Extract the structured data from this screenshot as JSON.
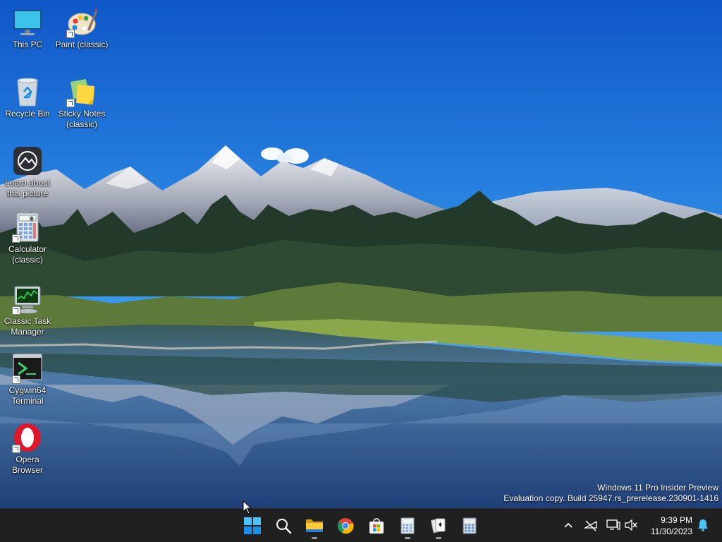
{
  "desktop": {
    "icons": [
      {
        "label": "This PC",
        "icon": "this-pc-icon"
      },
      {
        "label": "Paint (classic)",
        "icon": "paint-icon"
      },
      {
        "label": "Recycle Bin",
        "icon": "recycle-bin-icon"
      },
      {
        "label": "Sticky Notes (classic)",
        "icon": "sticky-notes-icon"
      },
      {
        "label": "Learn about this picture",
        "icon": "camera-icon"
      },
      {
        "label": "Calculator (classic)",
        "icon": "calculator-icon"
      },
      {
        "label": "Classic Task Manager",
        "icon": "task-manager-icon"
      },
      {
        "label": "Cygwin64 Terminal",
        "icon": "terminal-icon"
      },
      {
        "label": "Opera Browser",
        "icon": "opera-icon"
      }
    ]
  },
  "watermark": {
    "line1": "Windows 11 Pro Insider Preview",
    "line2": "Evaluation copy. Build 25947.rs_prerelease.230901-1416"
  },
  "taskbar": {
    "pinned": [
      {
        "name": "start-button",
        "icon": "windows-logo-icon",
        "running": false
      },
      {
        "name": "search-button",
        "icon": "search-icon",
        "running": false
      },
      {
        "name": "file-explorer-button",
        "icon": "folder-icon",
        "running": true
      },
      {
        "name": "chrome-button",
        "icon": "chrome-icon",
        "running": false
      },
      {
        "name": "store-button",
        "icon": "store-icon",
        "running": false
      },
      {
        "name": "calculator-button",
        "icon": "calculator-icon",
        "running": true
      },
      {
        "name": "solitaire-button",
        "icon": "cards-icon",
        "running": true
      },
      {
        "name": "calculator-classic-button",
        "icon": "calculator-icon",
        "running": false
      }
    ],
    "tray": {
      "chevron": "chevron-up-icon",
      "icons": [
        "network-disconnected-icon",
        "display-icon",
        "volume-muted-icon"
      ],
      "time": "9:39 PM",
      "date": "11/30/2023",
      "notification": "bell-icon"
    }
  },
  "colors": {
    "taskbar_bg": "#202020",
    "sky": "#1e6fd1",
    "accent": "#0078d4"
  }
}
